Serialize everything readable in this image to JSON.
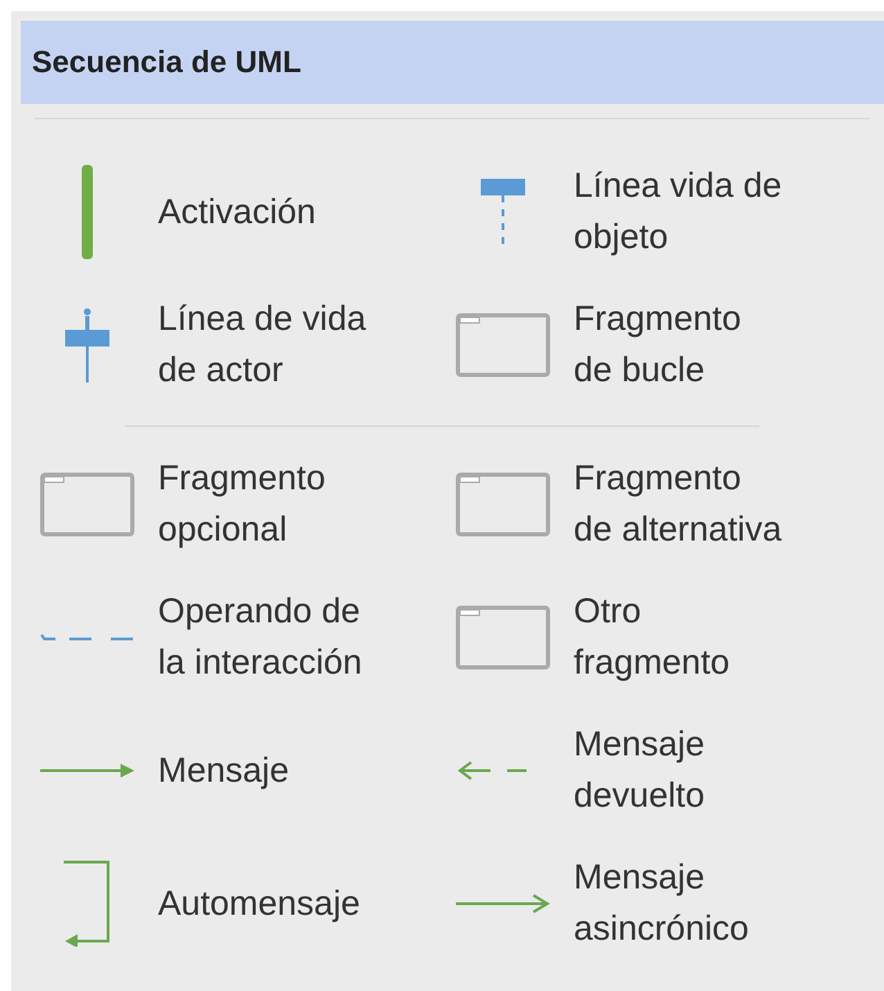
{
  "panel": {
    "title": "Secuencia de UML"
  },
  "sections": [
    {
      "rows": [
        {
          "items": [
            {
              "kind": "activation",
              "label": "Activación"
            },
            {
              "kind": "object-lifeline",
              "label": "Línea vida de\nobjeto"
            }
          ]
        },
        {
          "items": [
            {
              "kind": "actor-lifeline",
              "label": "Línea de vida\nde actor"
            },
            {
              "kind": "fragment",
              "label": "Fragmento\nde bucle"
            }
          ]
        }
      ]
    },
    {
      "rows": [
        {
          "items": [
            {
              "kind": "fragment",
              "label": "Fragmento\nopcional"
            },
            {
              "kind": "fragment",
              "label": "Fragmento\nde alternativa"
            }
          ]
        },
        {
          "items": [
            {
              "kind": "operand",
              "label": "Operando de\nla interacción"
            },
            {
              "kind": "fragment",
              "label": "Otro\nfragmento"
            }
          ]
        },
        {
          "items": [
            {
              "kind": "message",
              "label": "Mensaje"
            },
            {
              "kind": "return-message",
              "label": "Mensaje\ndevuelto"
            }
          ]
        },
        {
          "items": [
            {
              "kind": "self-message",
              "label": "Automensaje"
            },
            {
              "kind": "async-message",
              "label": "Mensaje\nasincrónico"
            }
          ]
        }
      ]
    }
  ]
}
